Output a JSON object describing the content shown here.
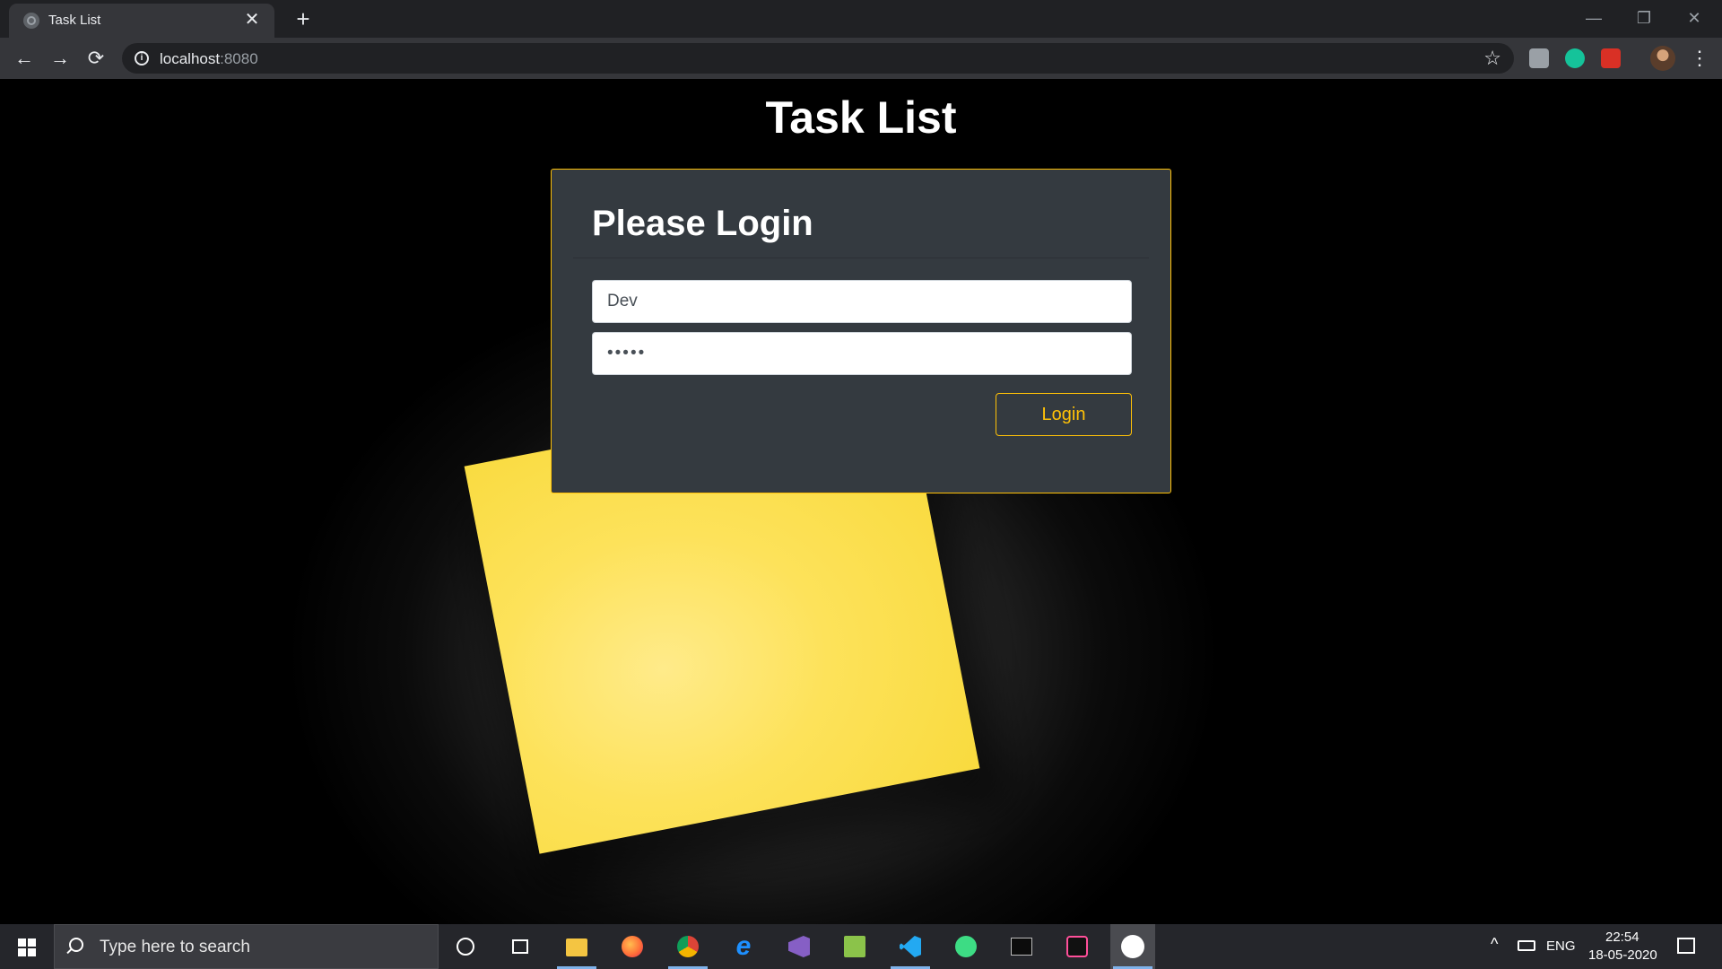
{
  "browser": {
    "tab_title": "Task List",
    "tab_close": "✕",
    "new_tab": "+",
    "url_host": "localhost",
    "url_port": ":8080",
    "window_controls": {
      "minimize": "—",
      "restore": "❐",
      "close": "✕"
    },
    "extensions": [
      "extension-icon",
      "grammarly-icon",
      "extension-red-icon"
    ]
  },
  "page": {
    "title": "Task List",
    "login_card": {
      "heading": "Please Login",
      "username_value": "Dev",
      "password_value": "•••••",
      "login_label": "Login"
    }
  },
  "taskbar": {
    "search_placeholder": "Type here to search",
    "apps": [
      "cortana",
      "task-view",
      "file-explorer",
      "firefox",
      "chrome",
      "edge",
      "visual-studio",
      "notepad-plus-plus",
      "vscode",
      "android-studio",
      "command-prompt",
      "terminal",
      "photos"
    ],
    "language": "ENG",
    "time": "22:54",
    "date": "18-05-2020"
  },
  "colors": {
    "accent": "#ffc107",
    "card_bg": "#343a40",
    "sticky_note": "#fde25a",
    "taskbar_bg": "#25262b"
  }
}
